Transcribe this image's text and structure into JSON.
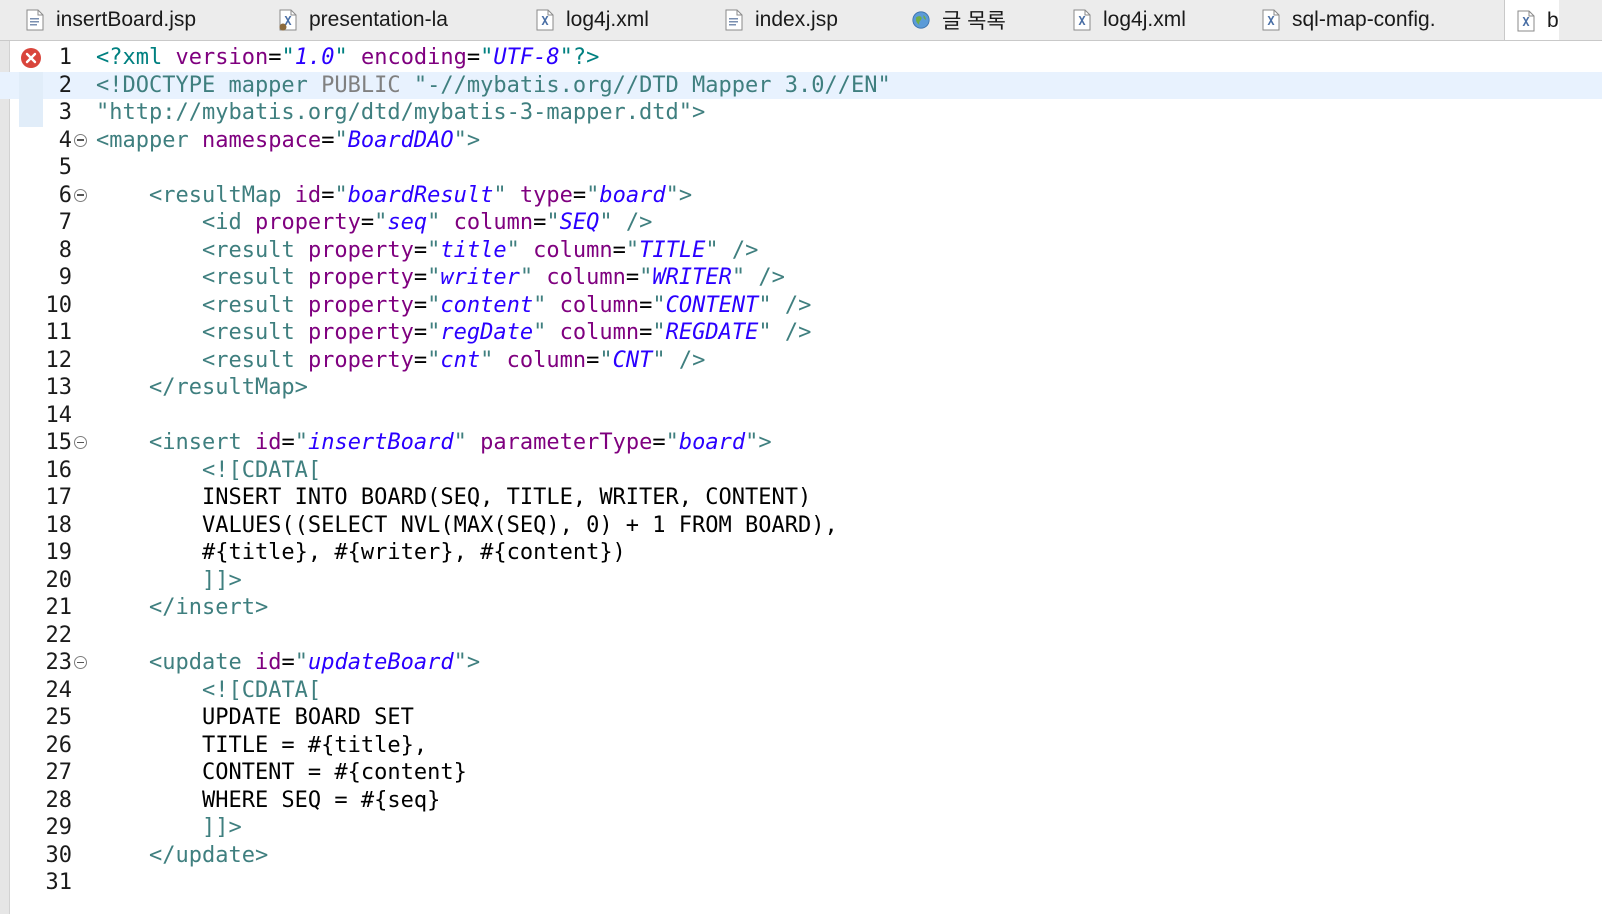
{
  "tabs": [
    {
      "label": "insertBoard.jsp",
      "icon": "jsp-file-icon"
    },
    {
      "label": "presentation-la",
      "icon": "spring-xml-file-icon"
    },
    {
      "label": "log4j.xml",
      "icon": "xml-file-icon"
    },
    {
      "label": "index.jsp",
      "icon": "jsp-file-icon"
    },
    {
      "label": "글 목록",
      "icon": "globe-icon"
    },
    {
      "label": "log4j.xml",
      "icon": "xml-file-icon"
    },
    {
      "label": "sql-map-config.",
      "icon": "xml-file-icon"
    },
    {
      "label": "b",
      "icon": "xml-file-icon"
    }
  ],
  "editor": {
    "line_numbers": [
      "1",
      "2",
      "3",
      "4",
      "5",
      "6",
      "7",
      "8",
      "9",
      "10",
      "11",
      "12",
      "13",
      "14",
      "15",
      "16",
      "17",
      "18",
      "19",
      "20",
      "21",
      "22",
      "23",
      "24",
      "25",
      "26",
      "27",
      "28",
      "29",
      "30",
      "31"
    ],
    "lines": [
      [
        [
          "pi",
          "<?xml "
        ],
        [
          "attr",
          "version"
        ],
        [
          "txt",
          "="
        ],
        [
          "pi",
          "\""
        ],
        [
          "val",
          "1.0"
        ],
        [
          "pi",
          "\" "
        ],
        [
          "attr",
          "encoding"
        ],
        [
          "txt",
          "="
        ],
        [
          "pi",
          "\""
        ],
        [
          "val",
          "UTF-8"
        ],
        [
          "pi",
          "\"?>"
        ]
      ],
      [
        [
          "dt",
          "<!DOCTYPE mapper "
        ],
        [
          "kw",
          "PUBLIC"
        ],
        [
          "dt",
          " \"-//mybatis.org//DTD Mapper 3.0//EN\""
        ]
      ],
      [
        [
          "str",
          "\"http://mybatis.org/dtd/mybatis-3-mapper.dtd\">"
        ]
      ],
      [
        [
          "tag",
          "<mapper "
        ],
        [
          "attr",
          "namespace"
        ],
        [
          "txt",
          "="
        ],
        [
          "tag",
          "\""
        ],
        [
          "val",
          "BoardDAO"
        ],
        [
          "tag",
          "\">"
        ]
      ],
      [],
      [
        [
          "txt",
          "    "
        ],
        [
          "tag",
          "<resultMap "
        ],
        [
          "attr",
          "id"
        ],
        [
          "txt",
          "="
        ],
        [
          "tag",
          "\""
        ],
        [
          "val",
          "boardResult"
        ],
        [
          "tag",
          "\" "
        ],
        [
          "attr",
          "type"
        ],
        [
          "txt",
          "="
        ],
        [
          "tag",
          "\""
        ],
        [
          "val",
          "board"
        ],
        [
          "tag",
          "\">"
        ]
      ],
      [
        [
          "txt",
          "        "
        ],
        [
          "tag",
          "<id "
        ],
        [
          "attr",
          "property"
        ],
        [
          "txt",
          "="
        ],
        [
          "tag",
          "\""
        ],
        [
          "val",
          "seq"
        ],
        [
          "tag",
          "\" "
        ],
        [
          "attr",
          "column"
        ],
        [
          "txt",
          "="
        ],
        [
          "tag",
          "\""
        ],
        [
          "val",
          "SEQ"
        ],
        [
          "tag",
          "\" />"
        ]
      ],
      [
        [
          "txt",
          "        "
        ],
        [
          "tag",
          "<result "
        ],
        [
          "attr",
          "property"
        ],
        [
          "txt",
          "="
        ],
        [
          "tag",
          "\""
        ],
        [
          "val",
          "title"
        ],
        [
          "tag",
          "\" "
        ],
        [
          "attr",
          "column"
        ],
        [
          "txt",
          "="
        ],
        [
          "tag",
          "\""
        ],
        [
          "val",
          "TITLE"
        ],
        [
          "tag",
          "\" />"
        ]
      ],
      [
        [
          "txt",
          "        "
        ],
        [
          "tag",
          "<result "
        ],
        [
          "attr",
          "property"
        ],
        [
          "txt",
          "="
        ],
        [
          "tag",
          "\""
        ],
        [
          "val",
          "writer"
        ],
        [
          "tag",
          "\" "
        ],
        [
          "attr",
          "column"
        ],
        [
          "txt",
          "="
        ],
        [
          "tag",
          "\""
        ],
        [
          "val",
          "WRITER"
        ],
        [
          "tag",
          "\" />"
        ]
      ],
      [
        [
          "txt",
          "        "
        ],
        [
          "tag",
          "<result "
        ],
        [
          "attr",
          "property"
        ],
        [
          "txt",
          "="
        ],
        [
          "tag",
          "\""
        ],
        [
          "val",
          "content"
        ],
        [
          "tag",
          "\" "
        ],
        [
          "attr",
          "column"
        ],
        [
          "txt",
          "="
        ],
        [
          "tag",
          "\""
        ],
        [
          "val",
          "CONTENT"
        ],
        [
          "tag",
          "\" />"
        ]
      ],
      [
        [
          "txt",
          "        "
        ],
        [
          "tag",
          "<result "
        ],
        [
          "attr",
          "property"
        ],
        [
          "txt",
          "="
        ],
        [
          "tag",
          "\""
        ],
        [
          "val",
          "regDate"
        ],
        [
          "tag",
          "\" "
        ],
        [
          "attr",
          "column"
        ],
        [
          "txt",
          "="
        ],
        [
          "tag",
          "\""
        ],
        [
          "val",
          "REGDATE"
        ],
        [
          "tag",
          "\" />"
        ]
      ],
      [
        [
          "txt",
          "        "
        ],
        [
          "tag",
          "<result "
        ],
        [
          "attr",
          "property"
        ],
        [
          "txt",
          "="
        ],
        [
          "tag",
          "\""
        ],
        [
          "val",
          "cnt"
        ],
        [
          "tag",
          "\" "
        ],
        [
          "attr",
          "column"
        ],
        [
          "txt",
          "="
        ],
        [
          "tag",
          "\""
        ],
        [
          "val",
          "CNT"
        ],
        [
          "tag",
          "\" />"
        ]
      ],
      [
        [
          "txt",
          "    "
        ],
        [
          "tag",
          "</resultMap>"
        ]
      ],
      [],
      [
        [
          "txt",
          "    "
        ],
        [
          "tag",
          "<insert "
        ],
        [
          "attr",
          "id"
        ],
        [
          "txt",
          "="
        ],
        [
          "tag",
          "\""
        ],
        [
          "val",
          "insertBoard"
        ],
        [
          "tag",
          "\" "
        ],
        [
          "attr",
          "parameterType"
        ],
        [
          "txt",
          "="
        ],
        [
          "tag",
          "\""
        ],
        [
          "val",
          "board"
        ],
        [
          "tag",
          "\">"
        ]
      ],
      [
        [
          "txt",
          "        "
        ],
        [
          "cdata",
          "<![CDATA["
        ]
      ],
      [
        [
          "txt",
          "        INSERT INTO BOARD(SEQ, TITLE, WRITER, CONTENT)"
        ]
      ],
      [
        [
          "txt",
          "        VALUES((SELECT NVL(MAX(SEQ), 0) + 1 FROM BOARD),"
        ]
      ],
      [
        [
          "txt",
          "        #{title}, #{writer}, #{content})"
        ]
      ],
      [
        [
          "txt",
          "        "
        ],
        [
          "cdata",
          "]]>"
        ]
      ],
      [
        [
          "txt",
          "    "
        ],
        [
          "tag",
          "</insert>"
        ]
      ],
      [],
      [
        [
          "txt",
          "    "
        ],
        [
          "tag",
          "<update "
        ],
        [
          "attr",
          "id"
        ],
        [
          "txt",
          "="
        ],
        [
          "tag",
          "\""
        ],
        [
          "val",
          "updateBoard"
        ],
        [
          "tag",
          "\">"
        ]
      ],
      [
        [
          "txt",
          "        "
        ],
        [
          "cdata",
          "<![CDATA["
        ]
      ],
      [
        [
          "txt",
          "        UPDATE BOARD SET"
        ]
      ],
      [
        [
          "txt",
          "        TITLE = #{title},"
        ]
      ],
      [
        [
          "txt",
          "        CONTENT = #{content}"
        ]
      ],
      [
        [
          "txt",
          "        WHERE SEQ = #{seq}"
        ]
      ],
      [
        [
          "txt",
          "        "
        ],
        [
          "cdata",
          "]]>"
        ]
      ],
      [
        [
          "txt",
          "    "
        ],
        [
          "tag",
          "</update>"
        ]
      ],
      []
    ],
    "foldable_lines": [
      4,
      6,
      15,
      23
    ],
    "error_lines": [
      1
    ],
    "highlighted_line": 2,
    "marker_icons": {
      "error": "error-icon",
      "fold": "fold-collapse-icon"
    },
    "colors": {
      "tag": "#3f7f7f",
      "attr": "#7f007f",
      "value": "#2a00ff",
      "text": "#000000",
      "line_highlight": "#e8f2fe",
      "error": "#d9453c"
    }
  }
}
